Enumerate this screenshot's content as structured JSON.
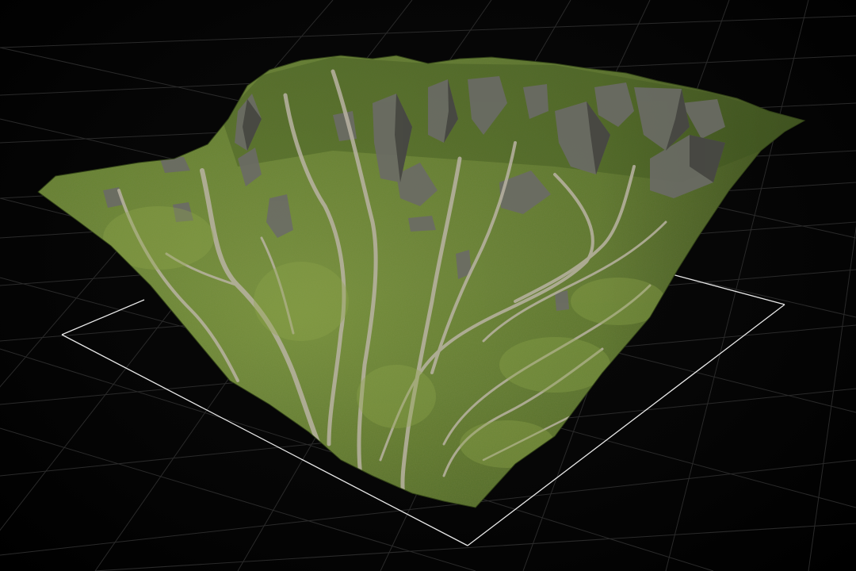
{
  "viewport": {
    "background_color": "#050505",
    "grid_color": "#2a2a2a",
    "bounds_color": "#e8e8e8"
  },
  "terrain": {
    "grass_color": "#4f6b26",
    "grass_light_color": "#8aa147",
    "rock_color": "#6b6b66",
    "gully_color": "#b9b3a3"
  }
}
